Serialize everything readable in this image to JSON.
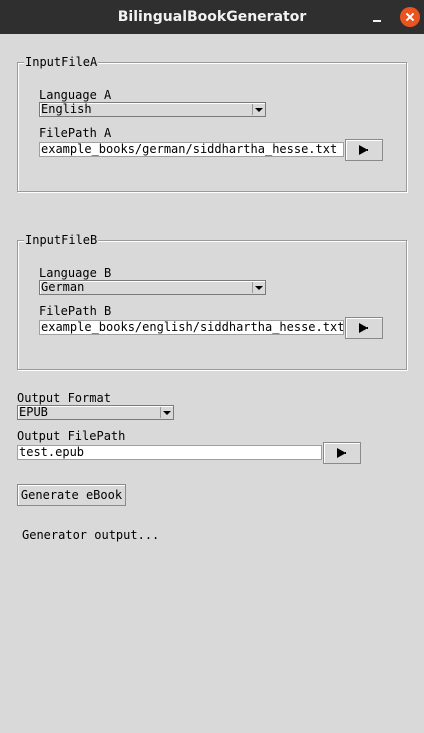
{
  "window": {
    "title": "BilingualBookGenerator"
  },
  "input_a": {
    "group_label": "InputFileA",
    "language_label": "Language A",
    "language_value": "English",
    "filepath_label": "FilePath A",
    "filepath_value": "example_books/german/siddhartha_hesse.txt"
  },
  "input_b": {
    "group_label": "InputFileB",
    "language_label": "Language B",
    "language_value": "German",
    "filepath_label": "FilePath B",
    "filepath_value": "example_books/english/siddhartha_hesse.txt"
  },
  "output": {
    "format_label": "Output Format",
    "format_value": "EPUB",
    "filepath_label": "Output FilePath",
    "filepath_value": "test.epub"
  },
  "generate_button": "Generate eBook",
  "status_text": "Generator output...",
  "icons": {
    "browse": "play-arrow-icon",
    "minimize": "minimize-icon",
    "close": "close-icon",
    "dropdown": "dropdown-arrow-icon"
  },
  "colors": {
    "window_bg": "#d9d9d9",
    "titlebar_bg": "#2f2f2f",
    "close_button": "#e95420"
  }
}
